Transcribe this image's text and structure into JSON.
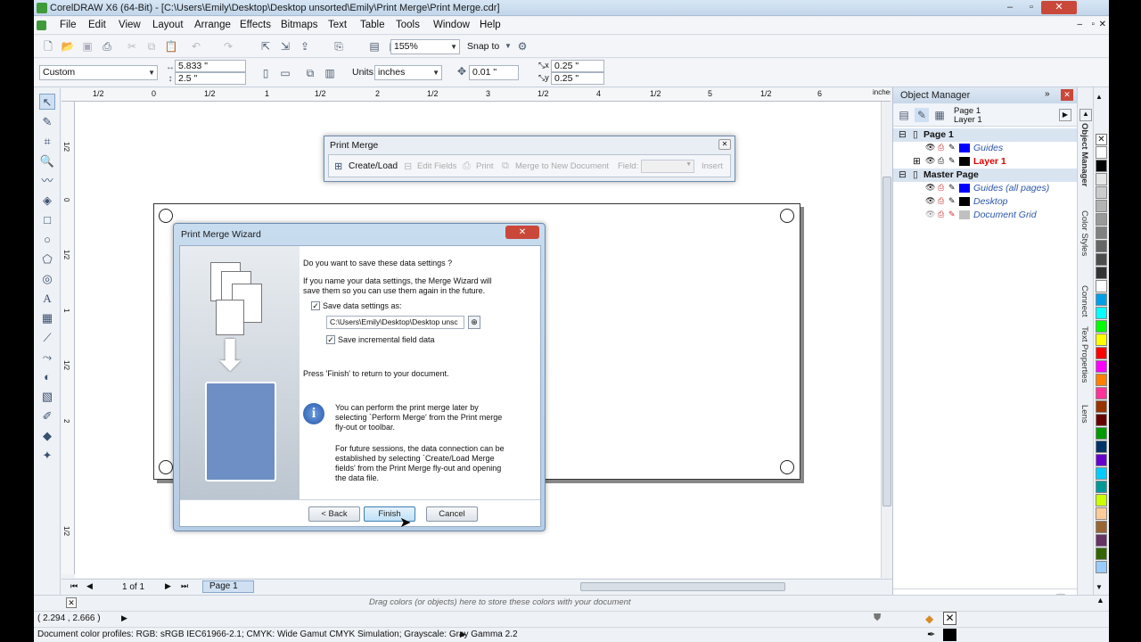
{
  "app": {
    "title": "CorelDRAW X6 (64-Bit) - [C:\\Users\\Emily\\Desktop\\Desktop unsorted\\Emily\\Print Merge\\Print Merge.cdr]"
  },
  "menu": [
    "File",
    "Edit",
    "View",
    "Layout",
    "Arrange",
    "Effects",
    "Bitmaps",
    "Text",
    "Table",
    "Tools",
    "Window",
    "Help"
  ],
  "toolbar": {
    "zoom": "155%",
    "snap_to": "Snap to"
  },
  "propbar": {
    "page_size": "Custom",
    "width": "5.833 \"",
    "height": "2.5 \"",
    "units_label": "Units:",
    "units": "inches",
    "nudge": "0.01 \"",
    "dup_x": "0.25 \"",
    "dup_y": "0.25 \""
  },
  "ruler": {
    "unit": "inches",
    "h_labels": [
      "1/2",
      "0",
      "1/2",
      "1",
      "1/2",
      "2",
      "1/2",
      "3",
      "1/2",
      "4",
      "1/2",
      "5",
      "1/2",
      "6"
    ],
    "v_labels": [
      "1/2",
      "0",
      "1/2",
      "1",
      "1/2",
      "2",
      "1/2"
    ]
  },
  "print_merge_toolbar": {
    "title": "Print Merge",
    "create_load": "Create/Load",
    "edit_fields": "Edit Fields",
    "print": "Print",
    "merge_to_new": "Merge to New Document",
    "field_label": "Field:",
    "insert": "Insert"
  },
  "wizard": {
    "title": "Print Merge Wizard",
    "question": "Do you want to save these data settings ?",
    "para1": "If you name your data settings, the Merge Wizard will save them so you can use them again in the future.",
    "save_settings_label": "Save data settings as:",
    "save_path": "C:\\Users\\Emily\\Desktop\\Desktop unsc",
    "incremental_label": "Save incremental field data",
    "finish_note": "Press 'Finish' to return to your document.",
    "info1": "You can perform the print merge later by selecting `Perform Merge' from the Print merge fly-out or toolbar.",
    "info2": "For future sessions, the data connection can be established by selecting `Create/Load Merge fields' from the Print Merge fly-out and opening the data file.",
    "back": "< Back",
    "finish": "Finish",
    "cancel": "Cancel"
  },
  "object_manager": {
    "title": "Object Manager",
    "page": "Page 1",
    "layer": "Layer 1",
    "tree": [
      {
        "label": "Page 1",
        "type": "header"
      },
      {
        "label": "Guides",
        "type": "layer",
        "color": "#0000ff",
        "italic": true
      },
      {
        "label": "Layer 1",
        "type": "layer",
        "color": "#000000",
        "active": true
      },
      {
        "label": "Master Page",
        "type": "header"
      },
      {
        "label": "Guides (all pages)",
        "type": "layer",
        "color": "#0000ff",
        "italic": true
      },
      {
        "label": "Desktop",
        "type": "layer",
        "color": "#000000",
        "italic": true
      },
      {
        "label": "Document Grid",
        "type": "layer",
        "color": "#c0c0c0",
        "italic": true
      }
    ]
  },
  "side_tabs": [
    "Object Manager",
    "Color Styles",
    "Connect",
    "Text Properties",
    "Lens"
  ],
  "page_nav": {
    "count": "1 of 1",
    "tab": "Page 1"
  },
  "status": {
    "color_drop_hint": "Drag colors (or objects) here to store these colors with your document",
    "coords": "( 2.294 , 2.666 )",
    "profiles": "Document color profiles: RGB: sRGB IEC61966-2.1; CMYK: Wide Gamut CMYK Simulation; Grayscale: Gray Gamma 2.2"
  },
  "palette": [
    "#ffffff",
    "#000000",
    "#e6e6e6",
    "#cccccc",
    "#b3b3b3",
    "#999999",
    "#808080",
    "#666666",
    "#4d4d4d",
    "#333333",
    "#ffffff",
    "#00a0e9",
    "#00ffff",
    "#00ff00",
    "#ffff00",
    "#ff0000",
    "#ff00ff",
    "#ff8000",
    "#ff3399",
    "#993300",
    "#660000",
    "#009900",
    "#003366",
    "#6600cc",
    "#00ccff",
    "#009999",
    "#ccff00",
    "#ffcc99",
    "#996633",
    "#663366",
    "#336600",
    "#99ccff"
  ]
}
